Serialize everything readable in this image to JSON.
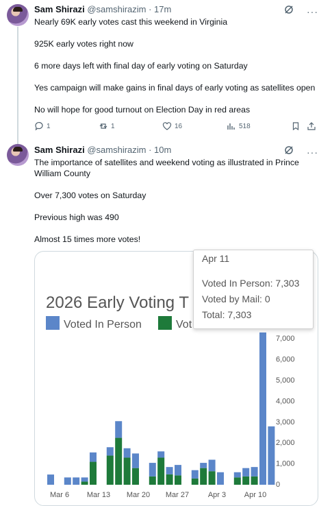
{
  "tweet1": {
    "name": "Sam Shirazi",
    "handle": "@samshirazim",
    "time": "· 17m",
    "lines": [
      "Nearly 69K early votes cast this weekend in Virginia",
      "925K early votes right now",
      "6 more days left with final day of early voting on Saturday",
      "Yes campaign will make gains in final days of early voting as satellites open",
      "No will hope for good turnout on Election Day in red areas"
    ],
    "replies": "1",
    "reposts": "1",
    "likes": "16",
    "views": "518"
  },
  "tweet2": {
    "name": "Sam Shirazi",
    "handle": "@samshirazim",
    "time": "· 10m",
    "lines": [
      "The importance of satellites and weekend voting as illustrated in Prince",
      "William County",
      "Over 7,300 votes on Saturday",
      "Previous high was 490",
      "Almost 15 times more votes!"
    ]
  },
  "chart_data": {
    "type": "bar",
    "title": "2026 Early Voting T",
    "legend": [
      "Voted In Person",
      "Vot"
    ],
    "x_tick_labels": [
      "Mar 6",
      "Mar 13",
      "Mar 20",
      "Mar 27",
      "Apr 3",
      "Apr 10"
    ],
    "y_tick_labels": [
      "0",
      "1,000",
      "2,000",
      "3,000",
      "4,000",
      "5,000",
      "6,000",
      "7,000"
    ],
    "ylim": [
      0,
      7300
    ],
    "colors": {
      "in_person": "#5b86c9",
      "mail": "#1e7a3a"
    },
    "bars": [
      {
        "in_person": 490,
        "mail": 0
      },
      {
        "in_person": 0,
        "mail": 0
      },
      {
        "in_person": 350,
        "mail": 0
      },
      {
        "in_person": 350,
        "mail": 0
      },
      {
        "in_person": 200,
        "mail": 150
      },
      {
        "in_person": 450,
        "mail": 1100
      },
      {
        "in_person": 0,
        "mail": 0
      },
      {
        "in_person": 400,
        "mail": 1400
      },
      {
        "in_person": 800,
        "mail": 2250
      },
      {
        "in_person": 450,
        "mail": 1300
      },
      {
        "in_person": 700,
        "mail": 800
      },
      {
        "in_person": 0,
        "mail": 0
      },
      {
        "in_person": 650,
        "mail": 400
      },
      {
        "in_person": 300,
        "mail": 1300
      },
      {
        "in_person": 350,
        "mail": 500
      },
      {
        "in_person": 500,
        "mail": 450
      },
      {
        "in_person": 0,
        "mail": 0
      },
      {
        "in_person": 400,
        "mail": 300
      },
      {
        "in_person": 250,
        "mail": 800
      },
      {
        "in_person": 550,
        "mail": 650
      },
      {
        "in_person": 600,
        "mail": 0
      },
      {
        "in_person": 0,
        "mail": 0
      },
      {
        "in_person": 250,
        "mail": 350
      },
      {
        "in_person": 400,
        "mail": 400
      },
      {
        "in_person": 450,
        "mail": 400
      },
      {
        "in_person": 7303,
        "mail": 0
      },
      {
        "in_person": 2800,
        "mail": 0
      }
    ],
    "tooltip": {
      "date": "Apr 11",
      "in_person": "Voted In Person: 7,303",
      "mail": "Voted by Mail: 0",
      "total": "Total: 7,303"
    }
  }
}
